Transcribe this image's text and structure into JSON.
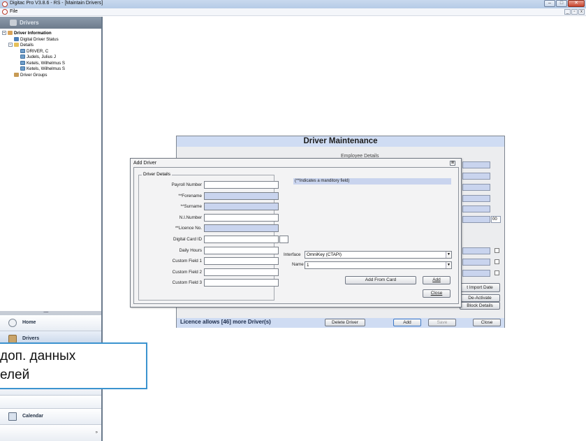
{
  "window": {
    "title": "Digitac Pro V3.8.6 - RS - [Maintain Drivers]",
    "min": "–",
    "max": "□",
    "close": "✕"
  },
  "menu": {
    "file": "File",
    "mdi_min": "_",
    "mdi_restore": "▫",
    "mdi_close": "x"
  },
  "sidebar": {
    "header": "Drivers",
    "tree": [
      {
        "label": "Driver Information",
        "level": 0,
        "expander": "−",
        "icon": "person",
        "bold": true
      },
      {
        "label": "Digital Driver Status",
        "level": 1,
        "expander": "",
        "icon": "status",
        "bold": false
      },
      {
        "label": "Details",
        "level": 1,
        "expander": "−",
        "icon": "folder",
        "bold": false
      },
      {
        "label": "DRIVER, C",
        "level": 2,
        "expander": "",
        "icon": "card",
        "bold": false
      },
      {
        "label": "Judels, Julius J",
        "level": 2,
        "expander": "",
        "icon": "card",
        "bold": false
      },
      {
        "label": "Ketels, Wilhelmus S",
        "level": 2,
        "expander": "",
        "icon": "card",
        "bold": false
      },
      {
        "label": "Ketels, Wilhelmus S",
        "level": 2,
        "expander": "",
        "icon": "card",
        "bold": false
      },
      {
        "label": "Driver Groups",
        "level": 1,
        "expander": "",
        "icon": "group",
        "bold": false
      }
    ],
    "nav": {
      "dots": "..........",
      "home": "Home",
      "drivers": "Drivers",
      "calendar": "Calendar",
      "overflow": "»"
    }
  },
  "driver_maintenance": {
    "title": "Driver Maintenance",
    "employee_label": "Employee Details",
    "small_field_value": "00",
    "import_date_btn": "t Import Date",
    "deactivate_btn": "De-Activate",
    "block_details_btn": "Block Details",
    "licence_text": "Licence allows [46] more Driver(s)",
    "delete_btn": "Delete Driver",
    "add_btn": "Add",
    "save_btn": "Save",
    "close_btn": "Close"
  },
  "add_driver": {
    "title": "Add Driver",
    "close": "⊠",
    "group_label": "Driver Details",
    "fields": [
      {
        "label": "Payroll Number",
        "value": "",
        "required": false
      },
      {
        "label": "**Forename",
        "value": "",
        "required": true
      },
      {
        "label": "**Surname",
        "value": "",
        "required": true
      },
      {
        "label": "N.I.Number",
        "value": "",
        "required": false
      },
      {
        "label": "**Licence No.",
        "value": "",
        "required": true
      },
      {
        "label": "Digital Card ID",
        "value": "",
        "required": false
      },
      {
        "label": "Daily Hours",
        "value": "",
        "required": false
      },
      {
        "label": "Custom Field 1",
        "value": "",
        "required": false
      },
      {
        "label": "Custom Field 2",
        "value": "",
        "required": false
      },
      {
        "label": "Custom Field 3",
        "value": "",
        "required": false
      }
    ],
    "note": "(**Indicates a manditory field)",
    "interface_label": "Interface",
    "interface_value": "OmniKey (CTAPI)",
    "name_label": "Name",
    "name_value": "1",
    "add_from_card_btn": "Add From Card",
    "add_btn": "Add",
    "close_btn": "Close"
  },
  "tooltip": {
    "text": "доп. данных\nелей"
  }
}
